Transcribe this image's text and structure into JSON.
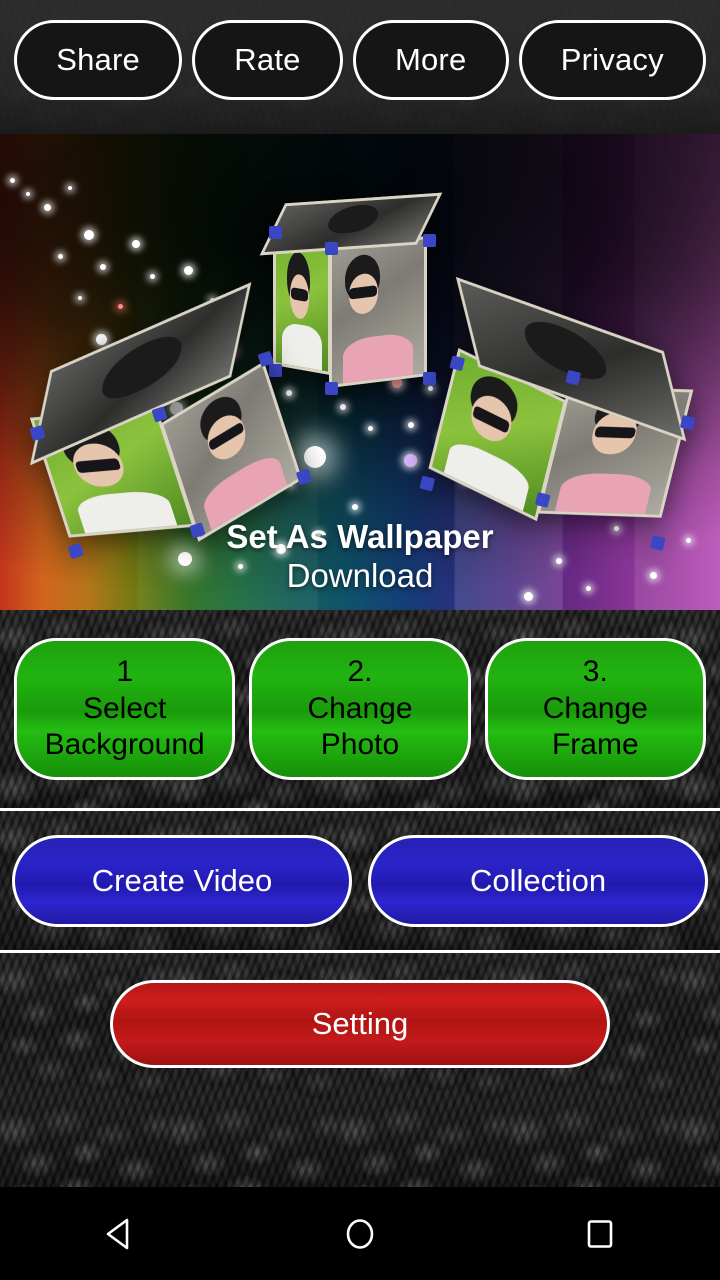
{
  "topbar": {
    "buttons": [
      {
        "label": "Share",
        "name": "share-button"
      },
      {
        "label": "Rate",
        "name": "rate-button"
      },
      {
        "label": "More",
        "name": "more-button"
      },
      {
        "label": "Privacy",
        "name": "privacy-button"
      }
    ]
  },
  "preview": {
    "overlay_line1": "Set As Wallpaper",
    "overlay_line2": "Download",
    "description": "3D photo cube live wallpaper preview with rainbow gradient background and glowing sparkle particles"
  },
  "green_row": {
    "buttons": [
      {
        "number": "1",
        "line1": "Select",
        "line2": "Background"
      },
      {
        "number": "2.",
        "line1": "Change",
        "line2": "Photo"
      },
      {
        "number": "3.",
        "line1": "Change",
        "line2": "Frame"
      }
    ]
  },
  "blue_row": {
    "buttons": [
      {
        "label": "Create Video"
      },
      {
        "label": "Collection"
      }
    ]
  },
  "setting_row": {
    "button_label": "Setting"
  },
  "navbar": {
    "back": "back-triangle-icon",
    "home": "home-circle-icon",
    "recents": "recents-square-icon"
  },
  "colors": {
    "green": "#1ea00e",
    "blue": "#2621b6",
    "red": "#b31616",
    "pill_fill": "#151515",
    "border": "#ffffff",
    "navbar": "#000000"
  }
}
